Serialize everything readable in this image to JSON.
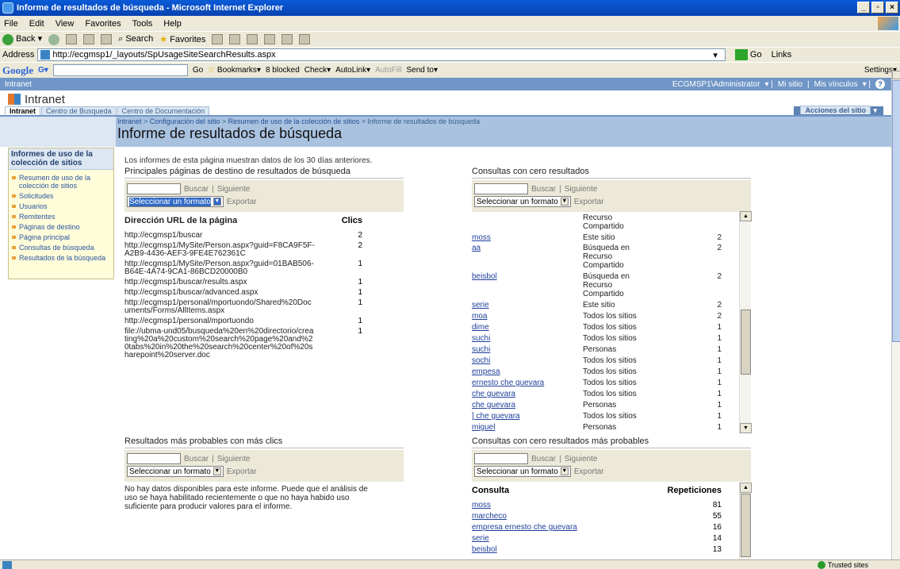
{
  "window": {
    "title": "Informe de resultados de búsqueda - Microsoft Internet Explorer",
    "buttons": [
      "_",
      "▫",
      "×"
    ]
  },
  "menu": [
    "File",
    "Edit",
    "View",
    "Favorites",
    "Tools",
    "Help"
  ],
  "toolbar": {
    "back": "Back",
    "search": "Search",
    "favorites": "Favorites"
  },
  "address": {
    "label": "Address",
    "url": "http://ecgmsp1/_layouts/SpUsageSiteSearchResults.aspx",
    "go": "Go",
    "links": "Links"
  },
  "googlebar": {
    "logo": "Google",
    "go": "Go",
    "bookmarks": "Bookmarks",
    "blocked": "8 blocked",
    "check": "Check",
    "autolink": "AutoLink",
    "autofill": "AutoFill",
    "sendto": "Send to",
    "settings": "Settings"
  },
  "sp": {
    "topbar_left": "Intranet",
    "user": "ECGMSP1\\Administrator",
    "mysite": "Mi sitio",
    "links": "Mis vínculos",
    "site_title": "Intranet",
    "tabs": [
      "Intranet",
      "Centro de Busqueda",
      "Centro de Documentación"
    ],
    "actions": "Acciones del sitio",
    "breadcrumb": [
      "Intranet",
      "Configuración del sitio",
      "Resumen de uso de la colección de sitios",
      "Informe de resultados de búsqueda"
    ],
    "page_title": "Informe de resultados de búsqueda",
    "leftnav_header": "Informes de uso de la colección de sitios",
    "leftnav": [
      "Resumen de uso de la colección de sitios",
      "Solicitudes",
      "Usuarios",
      "Remitentes",
      "Páginas de destino",
      "Página principal",
      "Consultas de búsqueda",
      "Resultados de la búsqueda"
    ],
    "intro": "Los informes de esta página muestran datos de los 30 días anteriores.",
    "buscar": "Buscar",
    "siguiente": "Siguiente",
    "sel_formato": "Seleccionar un formato",
    "exportar": "Exportar",
    "wp1": {
      "title": "Principales páginas de destino de resultados de búsqueda",
      "col1": "Dirección URL de la página",
      "col2": "Clics",
      "rows": [
        {
          "url": "http://ecgmsp1/buscar",
          "n": "2"
        },
        {
          "url": "http://ecgmsp1/MySite/Person.aspx?guid=F8CA9F5F-A2B9-4436-AEF3-9FE4E762361C",
          "n": "2"
        },
        {
          "url": "http://ecgmsp1/MySite/Person.aspx?guid=01BAB506-B64E-4A74-9CA1-86BCD20000B0",
          "n": "1"
        },
        {
          "url": "http://ecgmsp1/buscar/results.aspx",
          "n": "1"
        },
        {
          "url": "http://ecgmsp1/buscar/advanced.aspx",
          "n": "1"
        },
        {
          "url": "http://ecgmsp1/personal/mportuondo/Shared%20Documents/Forms/AllItems.aspx",
          "n": "1"
        },
        {
          "url": "http://ecgmsp1/personal/mportuondo",
          "n": "1"
        },
        {
          "url": "file://ubma-und05/busqueda%20en%20directorio/creating%20a%20custom%20search%20page%20and%20tabs%20in%20the%20search%20center%20of%20sharepoint%20server.doc",
          "n": "1"
        }
      ]
    },
    "wp2": {
      "title": "Consultas con cero resultados",
      "rows": [
        {
          "q": "",
          "s": "Recurso",
          "n": ""
        },
        {
          "q": "",
          "s": "Compartido",
          "n": ""
        },
        {
          "q": "moss",
          "s": "Este sitio",
          "n": "2"
        },
        {
          "q": "aa",
          "s": "Búsqueda en",
          "n": "2"
        },
        {
          "q": "",
          "s": "Recurso",
          "n": ""
        },
        {
          "q": "",
          "s": "Compartido",
          "n": ""
        },
        {
          "q": "beisbol",
          "s": "Búsqueda en",
          "n": "2"
        },
        {
          "q": "",
          "s": "Recurso",
          "n": ""
        },
        {
          "q": "",
          "s": "Compartido",
          "n": ""
        },
        {
          "q": "serie",
          "s": "Este sitio",
          "n": "2"
        },
        {
          "q": "moa",
          "s": "Todos los sitios",
          "n": "2"
        },
        {
          "q": "dime",
          "s": "Todos los sitios",
          "n": "1"
        },
        {
          "q": "suchi",
          "s": "Todos los sitios",
          "n": "1"
        },
        {
          "q": "suchi",
          "s": "Personas",
          "n": "1"
        },
        {
          "q": "sochi",
          "s": "Todos los sitios",
          "n": "1"
        },
        {
          "q": "empesa",
          "s": "Todos los sitios",
          "n": "1"
        },
        {
          "q": "ernesto che guevara",
          "s": "Todos los sitios",
          "n": "1"
        },
        {
          "q": "che guevara",
          "s": "Todos los sitios",
          "n": "1"
        },
        {
          "q": "che guevara",
          "s": "Personas",
          "n": "1"
        },
        {
          "q": "] che guevara",
          "s": "Todos los sitios",
          "n": "1"
        },
        {
          "q": "miguel",
          "s": "Personas",
          "n": "1"
        }
      ]
    },
    "wp3": {
      "title": "Resultados más probables con más clics",
      "nodata": "No hay datos disponibles para este informe. Puede que el análisis de uso se haya habilitado recientemente o que no haya habido uso suficiente para producir valores para el informe."
    },
    "wp4": {
      "title": "Consultas con cero resultados más probables",
      "col1": "Consulta",
      "col2": "Repeticiones",
      "rows": [
        {
          "q": "moss",
          "n": "81"
        },
        {
          "q": "marcheco",
          "n": "55"
        },
        {
          "q": "empresa ernesto che guevara",
          "n": "16"
        },
        {
          "q": "serie",
          "n": "14"
        },
        {
          "q": "beisbol",
          "n": "13"
        }
      ]
    }
  },
  "status": {
    "zone": "Trusted sites"
  }
}
